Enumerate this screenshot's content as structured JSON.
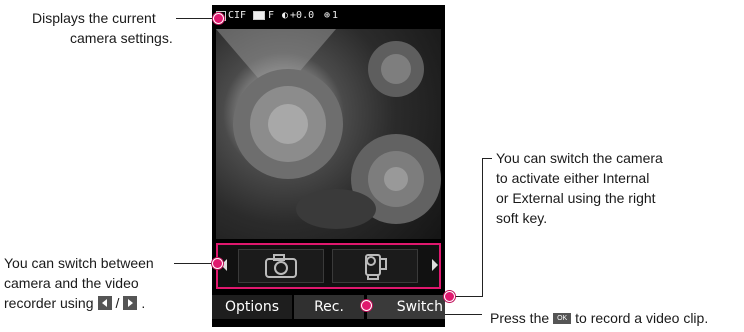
{
  "callouts": {
    "settings": [
      "Displays the current",
      "camera settings."
    ],
    "switch_camera": [
      "You can switch the camera",
      "to activate either Internal",
      "or External using the right",
      "soft key."
    ],
    "switch_mode_line1": "You can switch between",
    "switch_mode_line2": "camera and the video",
    "switch_mode_line3_prefix": "recorder using",
    "switch_mode_separator": "/",
    "switch_mode_line3_suffix": ".",
    "record_prefix": "Press the",
    "record_key": "OK",
    "record_suffix": "to record a video clip."
  },
  "status_bar": {
    "resolution": "CIF",
    "quality_label": "F",
    "brightness": "+0.0",
    "zoom": "1"
  },
  "softkeys": {
    "left": "Options",
    "middle": "Rec.",
    "right": "Switch"
  },
  "colors": {
    "accent": "#e0186e"
  }
}
